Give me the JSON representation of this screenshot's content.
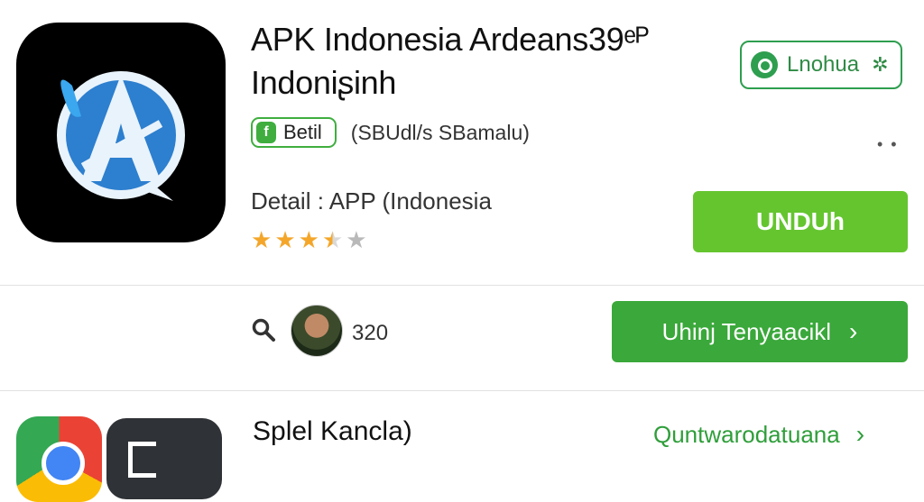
{
  "app": {
    "title_line1": "APK Indonesia Ardeans39ᵉᴾ",
    "title_line2": "Indoniʂinh",
    "language_badge": "Lnohua",
    "tag_label": "Betil",
    "tag_icon": "f",
    "tag_subtitle": "(SBUdl/s SBamalu)",
    "detail_text": "Detail : APP (Indonesia",
    "rating": 3.5,
    "rating_max": 5,
    "download_button": "UNDUh"
  },
  "social": {
    "count": "320",
    "translate_button": "Uhinj Tenyaacikl"
  },
  "section": {
    "title": "Splel Kancla)",
    "link": "Quntwarodatuana"
  },
  "colors": {
    "accent_green": "#65c52f",
    "button_green": "#3aa83a",
    "star": "#f4a62a",
    "icon_blue": "#3aa7ee"
  },
  "icons": {
    "app_icon": "a-letter-circle-icon",
    "language": "location-pin-icon",
    "search": "search-icon",
    "more": "more-dots-icon",
    "chevron": "chevron-right-icon"
  }
}
